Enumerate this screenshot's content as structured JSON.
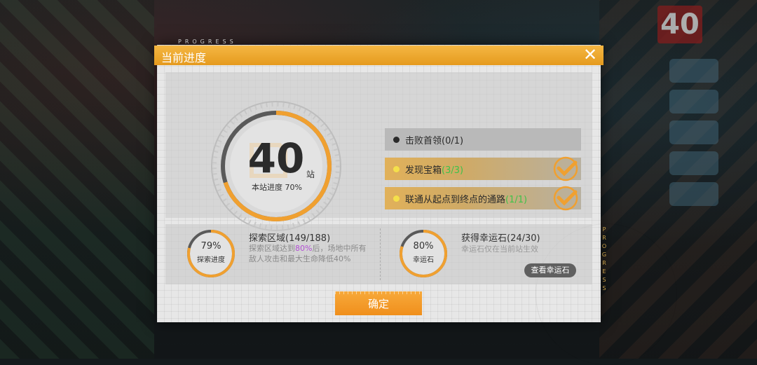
{
  "header": {
    "title": "当前进度",
    "progress_tag": "PROGRESS"
  },
  "stage": {
    "number": "40",
    "unit": "站",
    "progress_label": "本站进度 70%",
    "progress_fraction": 0.7
  },
  "tasks": [
    {
      "label": "击败首领",
      "count": "(0/1)",
      "done": false
    },
    {
      "label": "发现宝箱",
      "count": "(3/3)",
      "done": true
    },
    {
      "label": "联通从起点到终点的通路",
      "count": "(1/1)",
      "done": true
    }
  ],
  "explore": {
    "percent": "79%",
    "percent_fraction": 0.79,
    "ring_label": "探索进度",
    "title": "探索区域(149/188)",
    "desc_prefix": "探索区域达到",
    "desc_highlight": "80%",
    "desc_suffix": "后，场地中所有敌人攻击和最大生命降低40%"
  },
  "luck": {
    "percent": "80%",
    "percent_fraction": 0.8,
    "ring_label": "幸运石",
    "title": "获得幸运石(24/30)",
    "desc": "幸运石仅在当前站生效",
    "view_button": "查看幸运石"
  },
  "confirm_label": "确定",
  "side_tag": "PROGRESS",
  "background": {
    "badge": "40"
  },
  "colors": {
    "accent": "#f0a030",
    "done_green": "#3ec24a",
    "highlight_purple": "#b24fd4",
    "dot_yellow": "#f5e04a"
  },
  "icons": {
    "close": "close-icon",
    "check": "check-icon",
    "dot": "bullet-dot-icon"
  }
}
